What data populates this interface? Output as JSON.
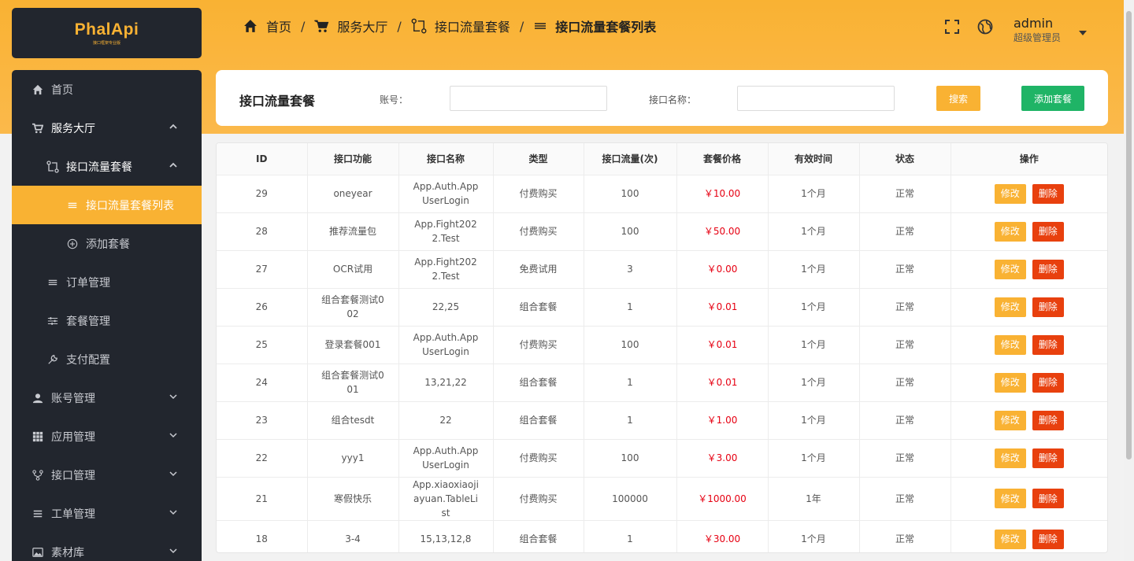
{
  "brand": {
    "logo_text": "PhalApi",
    "logo_sub": "接口框架专业版"
  },
  "sidebar": {
    "items": [
      {
        "label": "首页",
        "icon": "home-icon",
        "level": 1,
        "state": "normal"
      },
      {
        "label": "服务大厅",
        "icon": "cart-icon",
        "level": 1,
        "state": "open"
      },
      {
        "label": "接口流量套餐",
        "icon": "branch-icon",
        "level": 2,
        "state": "open"
      },
      {
        "label": "接口流量套餐列表",
        "icon": "list-icon",
        "level": 3,
        "state": "active"
      },
      {
        "label": "添加套餐",
        "icon": "plus-circle-icon",
        "level": 3,
        "state": "normal"
      },
      {
        "label": "订单管理",
        "icon": "list-icon",
        "level": 2,
        "state": "normal"
      },
      {
        "label": "套餐管理",
        "icon": "sliders-icon",
        "level": 2,
        "state": "normal"
      },
      {
        "label": "支付配置",
        "icon": "wrench-icon",
        "level": 2,
        "state": "normal"
      },
      {
        "label": "账号管理",
        "icon": "user-icon",
        "level": 1,
        "state": "collapsed"
      },
      {
        "label": "应用管理",
        "icon": "grid-icon",
        "level": 1,
        "state": "collapsed"
      },
      {
        "label": "接口管理",
        "icon": "fork-icon",
        "level": 1,
        "state": "collapsed"
      },
      {
        "label": "工单管理",
        "icon": "menu-icon",
        "level": 1,
        "state": "collapsed"
      },
      {
        "label": "素材库",
        "icon": "image-icon",
        "level": 1,
        "state": "collapsed"
      }
    ]
  },
  "breadcrumb": {
    "items": [
      {
        "label": "首页",
        "icon": "home-icon"
      },
      {
        "label": "服务大厅",
        "icon": "cart-icon"
      },
      {
        "label": "接口流量套餐",
        "icon": "branch-icon"
      },
      {
        "label": "接口流量套餐列表",
        "icon": "list-icon"
      }
    ],
    "separator": "/"
  },
  "header": {
    "user_name": "admin",
    "user_role": "超级管理员"
  },
  "filter": {
    "title": "接口流量套餐",
    "account_label": "账号：",
    "account_value": "",
    "api_name_label": "接口名称：",
    "api_name_value": "",
    "search_button": "搜索",
    "add_button": "添加套餐"
  },
  "table": {
    "columns": [
      "ID",
      "接口功能",
      "接口名称",
      "类型",
      "接口流量(次)",
      "套餐价格",
      "有效时间",
      "状态",
      "操作"
    ],
    "edit_label": "修改",
    "delete_label": "删除",
    "rows": [
      {
        "id": "29",
        "func": "oneyear",
        "api": "App.Auth.AppUserLogin",
        "type": "付费购买",
        "flow": "100",
        "price": "￥10.00",
        "period": "1个月",
        "status": "正常"
      },
      {
        "id": "28",
        "func": "推荐流量包",
        "api": "App.Fight2022.Test",
        "type": "付费购买",
        "flow": "100",
        "price": "￥50.00",
        "period": "1个月",
        "status": "正常"
      },
      {
        "id": "27",
        "func": "OCR试用",
        "api": "App.Fight2022.Test",
        "type": "免费试用",
        "flow": "3",
        "price": "￥0.00",
        "period": "1个月",
        "status": "正常"
      },
      {
        "id": "26",
        "func": "组合套餐测试002",
        "api": "22,25",
        "type": "组合套餐",
        "flow": "1",
        "price": "￥0.01",
        "period": "1个月",
        "status": "正常"
      },
      {
        "id": "25",
        "func": "登录套餐001",
        "api": "App.Auth.AppUserLogin",
        "type": "付费购买",
        "flow": "100",
        "price": "￥0.01",
        "period": "1个月",
        "status": "正常"
      },
      {
        "id": "24",
        "func": "组合套餐测试001",
        "api": "13,21,22",
        "type": "组合套餐",
        "flow": "1",
        "price": "￥0.01",
        "period": "1个月",
        "status": "正常"
      },
      {
        "id": "23",
        "func": "组合tesdt",
        "api": "22",
        "type": "组合套餐",
        "flow": "1",
        "price": "￥1.00",
        "period": "1个月",
        "status": "正常"
      },
      {
        "id": "22",
        "func": "yyy1",
        "api": "App.Auth.AppUserLogin",
        "type": "付费购买",
        "flow": "100",
        "price": "￥3.00",
        "period": "1个月",
        "status": "正常"
      },
      {
        "id": "21",
        "func": "寒假快乐",
        "api": "App.xiaoxiaojiayuan.TableList",
        "type": "付费购买",
        "flow": "100000",
        "price": "￥1000.00",
        "period": "1年",
        "status": "正常"
      },
      {
        "id": "18",
        "func": "3-4",
        "api": "15,13,12,8",
        "type": "组合套餐",
        "flow": "1",
        "price": "￥30.00",
        "period": "1个月",
        "status": "正常"
      }
    ]
  },
  "colors": {
    "accent": "#f9b233",
    "sidebar_bg": "#22262e",
    "add_green": "#1fb466",
    "delete_red": "#e8400e",
    "price_red": "#e60012"
  }
}
